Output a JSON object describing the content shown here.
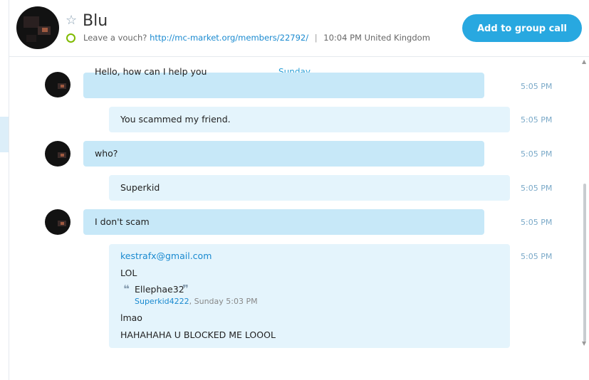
{
  "header": {
    "contact_name": "Blu",
    "mood_prefix": "Leave a vouch?",
    "mood_link": "http://mc-market.org/members/22792/",
    "separator": "|",
    "local_time": "10:04 PM United Kingdom",
    "call_button": "Add to group call"
  },
  "conversation": {
    "day_label": "Sunday",
    "messages": [
      {
        "direction": "incoming",
        "text": "Hello, how can I help you",
        "time": "5:05 PM"
      },
      {
        "direction": "outgoing",
        "text": "You scammed my friend.",
        "time": "5:05 PM"
      },
      {
        "direction": "incoming",
        "text": "who?",
        "time": "5:05 PM"
      },
      {
        "direction": "outgoing",
        "text": "Superkid",
        "time": "5:05 PM"
      },
      {
        "direction": "incoming",
        "text": "I don't scam",
        "time": "5:05 PM"
      }
    ],
    "email_message": {
      "sender": "kestrafx@gmail.com",
      "time": "5:05 PM",
      "line1": "LOL",
      "quote_name": "Ellephae32",
      "quote_author": "Superkid4222",
      "quote_when": ", Sunday 5:03 PM",
      "line2": "lmao",
      "line3": "HAHAHAHA U BLOCKED ME LOOOL"
    }
  },
  "icons": {
    "star": "star-icon",
    "status": "presence-status-icon"
  },
  "colors": {
    "accent": "#28a8e0",
    "incoming_bubble": "#c7e8f8",
    "outgoing_bubble": "#e4f4fc",
    "link": "#1a8ad0",
    "status_online": "#7fba00"
  }
}
